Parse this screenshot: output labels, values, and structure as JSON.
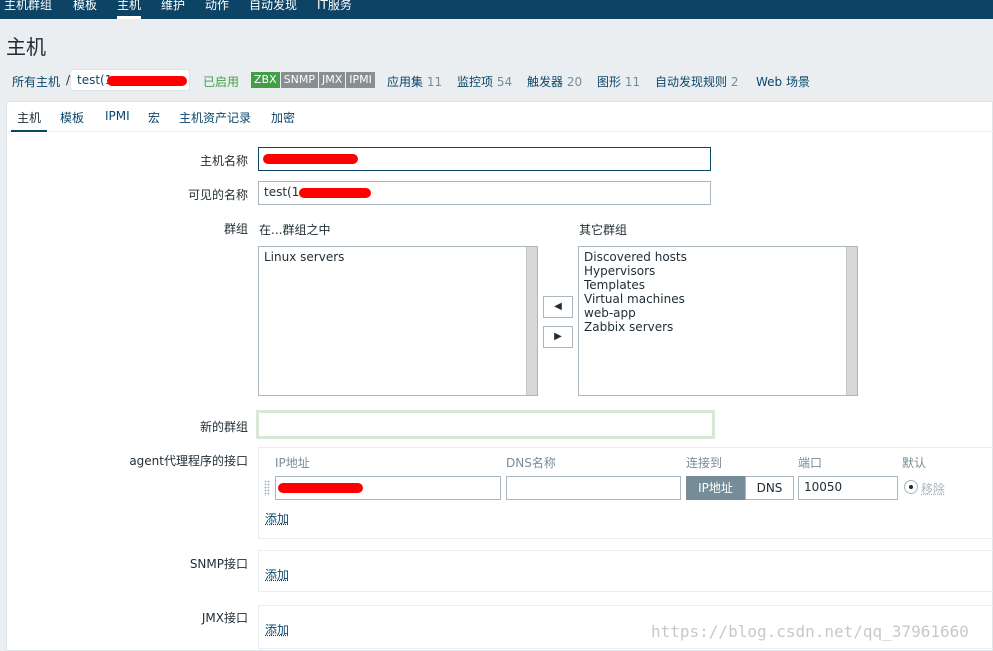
{
  "topnav": [
    "主机群组",
    "模板",
    "主机",
    "维护",
    "动作",
    "自动发现",
    "IT服务"
  ],
  "page_title": "主机",
  "breadcrumb": {
    "all_hosts": "所有主机",
    "sep": "/",
    "host": "test(1",
    "status": "已启用",
    "badges": [
      "ZBX",
      "SNMP",
      "JMX",
      "IPMI"
    ],
    "links": [
      {
        "label": "应用集",
        "count": "11"
      },
      {
        "label": "监控项",
        "count": "54"
      },
      {
        "label": "触发器",
        "count": "20"
      },
      {
        "label": "图形",
        "count": "11"
      },
      {
        "label": "自动发现规则",
        "count": "2"
      },
      {
        "label": "Web 场景",
        "count": ""
      }
    ]
  },
  "tabs": [
    "主机",
    "模板",
    "IPMI",
    "宏",
    "主机资产记录",
    "加密"
  ],
  "form": {
    "hostname_label": "主机名称",
    "hostname_value": "",
    "visible_label": "可见的名称",
    "visible_value": "test(1",
    "groups_label": "群组",
    "in_groups_label": "在...群组之中",
    "other_groups_label": "其它群组",
    "in_groups": [
      "Linux servers"
    ],
    "other_groups": [
      "Discovered hosts",
      "Hypervisors",
      "Templates",
      "Virtual machines",
      "web-app",
      "Zabbix servers"
    ],
    "left_arrow": "◀",
    "right_arrow": "▶",
    "new_group_label": "新的群组",
    "new_group_value": "",
    "agent_label": "agent代理程序的接口",
    "col_ip": "IP地址",
    "col_dns": "DNS名称",
    "col_connect": "连接到",
    "col_port": "端口",
    "col_default": "默认",
    "ip_value": "",
    "dns_value": "",
    "connect_ip": "IP地址",
    "connect_dns": "DNS",
    "port_value": "10050",
    "remove": "移除",
    "add": "添加",
    "snmp_label": "SNMP接口",
    "jmx_label": "JMX接口"
  },
  "watermark": "https://blog.csdn.net/qq_37961660",
  "colors": {
    "nav": "#0d4466",
    "link": "#0a466a",
    "enabled": "#429e47"
  }
}
